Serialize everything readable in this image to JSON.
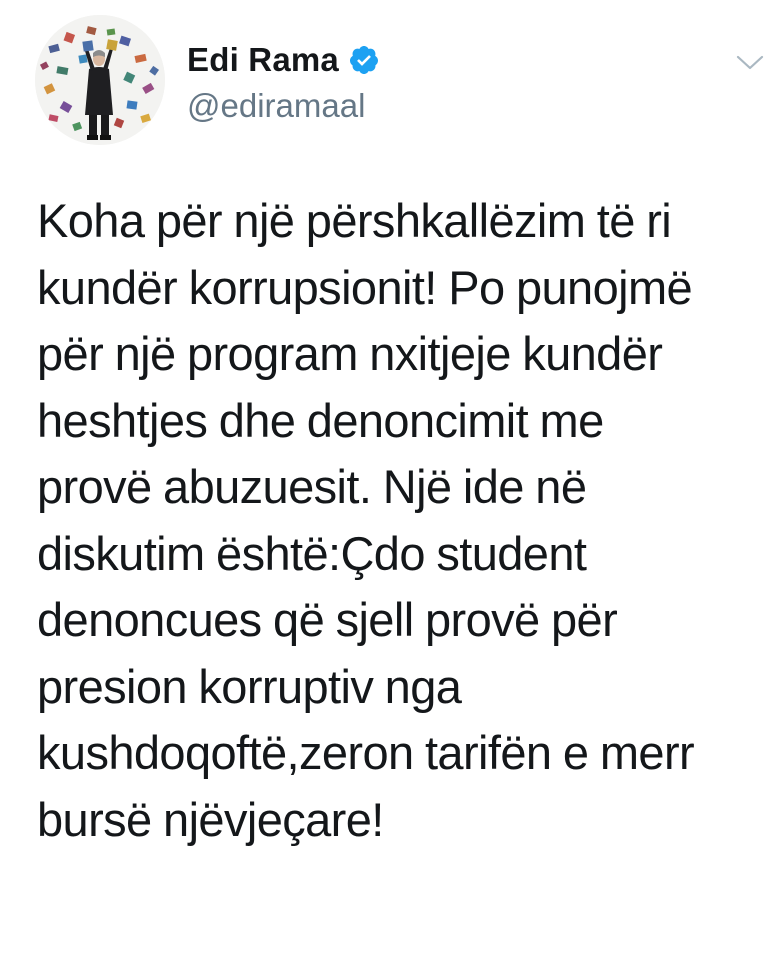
{
  "tweet": {
    "author": {
      "display_name": "Edi Rama",
      "handle": "@ediramaal",
      "verified": true,
      "avatar_icon": "profile-photo",
      "verified_icon": "verified-badge-icon",
      "verified_color": "#1da1f2"
    },
    "menu_icon": "chevron-down-icon",
    "text_lines": [
      "Koha për një përshkallëzim të ri",
      "kundër korrupsionit! Po punojmë",
      "për një program nxitjeje kundër",
      "heshtjes dhe denoncimit me",
      "provë abuzuesit. Një ide në",
      "diskutim është:Çdo student",
      "denoncues që sjell provë për",
      "presion korruptiv nga",
      "kushdoqoftë,zeron tarifën e merr",
      "bursë njëvjeçare!"
    ]
  },
  "colors": {
    "text": "#14171a",
    "secondary_text": "#657786",
    "caret": "#aab8c2",
    "background": "#ffffff"
  }
}
